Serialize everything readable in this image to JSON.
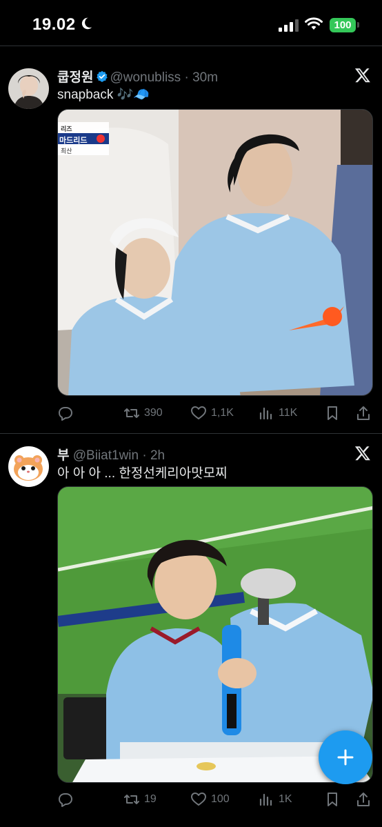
{
  "status_bar": {
    "time": "19.02",
    "battery": "100"
  },
  "tweets": [
    {
      "display_name": "쿱정원",
      "handle": "@wonubliss",
      "time": "30m",
      "verified": true,
      "text": "snapback 🎶🧢",
      "media_overlay": {
        "line1": "리즈",
        "line2": "마드리드",
        "line3": "최산"
      },
      "replies": "",
      "retweets": "390",
      "likes": "1,1K",
      "views": "11K"
    },
    {
      "display_name": "부",
      "handle": "@Biiat1win",
      "time": "2h",
      "verified": false,
      "text": "아 아 아 ... 한정선케리아맛모찌",
      "replies": "",
      "retweets": "19",
      "likes": "100",
      "views": "1K"
    }
  ],
  "colors": {
    "background": "#000000",
    "text": "#e7e9ea",
    "secondary": "#71767b",
    "accent": "#1d9bf0",
    "battery": "#34c759"
  },
  "icons": {
    "reply": "reply-icon",
    "retweet": "retweet-icon",
    "like": "heart-icon",
    "views": "views-icon",
    "bookmark": "bookmark-icon",
    "share": "share-icon",
    "compose": "plus-icon"
  }
}
